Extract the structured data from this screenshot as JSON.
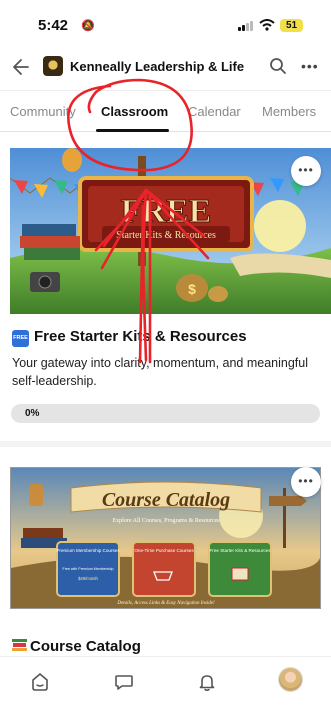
{
  "status_bar": {
    "time": "5:42",
    "battery": "51"
  },
  "header": {
    "title": "Kenneally Leadership & Life"
  },
  "tabs": [
    {
      "label": "Community",
      "active": false
    },
    {
      "label": "Classroom",
      "active": true
    },
    {
      "label": "Calendar",
      "active": false
    },
    {
      "label": "Members",
      "active": false
    }
  ],
  "courses": [
    {
      "badge": "FREE",
      "title": "Free Starter Kits & Resources",
      "description": "Your gateway into clarity, momentum, and meaningful self-leadership.",
      "progress_label": "0%",
      "progress": 0,
      "banner": {
        "headline": "FREE",
        "subline": "Starter Kits & Resources"
      }
    },
    {
      "title": "Course Catalog",
      "banner": {
        "headline": "Course Catalog",
        "subline": "Explore All Courses, Programs & Resources",
        "panels": [
          {
            "title": "Premium Membership Courses",
            "tag": "Free with Premium Membership",
            "price": "$49/month"
          },
          {
            "title": "One-Time Purchase Courses"
          },
          {
            "title": "Free Starter Kits & Resources"
          }
        ],
        "footer": "Details, Access Links & Easy Navigation Inside!"
      }
    }
  ],
  "icons": {
    "back": "arrow-left-icon",
    "search": "search-icon",
    "more": "more-horizontal-icon",
    "home": "home-icon",
    "chat": "chat-bubble-icon",
    "bell": "bell-icon"
  },
  "colors": {
    "accent": "#111111",
    "annotation": "#e8232a",
    "battery": "#f2e04a"
  }
}
